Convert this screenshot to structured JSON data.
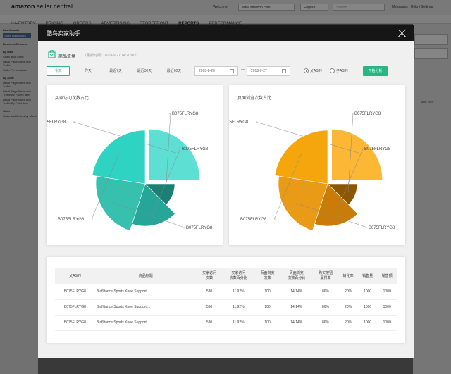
{
  "background": {
    "logo_bold": "amazon",
    "logo_rest": " seller central",
    "welcome": "Welcome",
    "marketplace": "www.amazon.com",
    "language": "English",
    "search_placeholder": "Search",
    "links": "Messages | Help | Settings",
    "nav": [
      "INVENTORY",
      "PRICING",
      "ORDERS",
      "ADVERTISING",
      "STOREFRONT",
      "REPORTS",
      "PERFORMANCE"
    ],
    "sidebar": [
      "Dashboards",
      "Sales Dashboard",
      "Business Reports",
      "By Date",
      "Sales and Traffic",
      "Detail Page Sales and Traffic",
      "Seller Performance",
      "By ASIN",
      "Detail Page Sales and Traffic",
      "Detail Page Sales and Traffic By Parent Item",
      "Detail Page Sales and Traffic By Child Item",
      "Other",
      "Sales and Orders by Month"
    ],
    "right_label": "Table View"
  },
  "modal": {
    "title": "酷鸟卖家助手",
    "section_title": "商品流量",
    "update_time": "（更新时间：2018-9-27 14:20:00）",
    "date_tabs": [
      "今天",
      "昨天",
      "最近7天",
      "最近30天",
      "最近60天"
    ],
    "active_tab": "今天",
    "start_date": "2018-8-26",
    "end_date": "2018-9-27",
    "date_separator": "—",
    "radio_parent": "父ASIN",
    "radio_child": "子ASIN",
    "analyze_button": "开始分析"
  },
  "chart_data": [
    {
      "type": "pie",
      "title": "买家访问次数占比",
      "categories": [
        "B075FLRYG8",
        "B075FLRYG8",
        "B075FLRYG8",
        "B075FLRYG8",
        "B075FLRYG8"
      ],
      "values": [
        25,
        12.5,
        17.5,
        22.5,
        22.5
      ],
      "colors": [
        "#5edfd4",
        "#1b7f74",
        "#26a699",
        "#37c0ae",
        "#2ed3c1"
      ]
    },
    {
      "type": "pie",
      "title": "页面浏览次数占比",
      "categories": [
        "B075FLRYG8",
        "B075FLRYG8",
        "B075FLRYG8",
        "B075FLRYG8",
        "B075FLRYG8"
      ],
      "values": [
        25,
        12.5,
        17.5,
        22.5,
        22.5
      ],
      "colors": [
        "#fcb734",
        "#8d5700",
        "#c97d08",
        "#e99a16",
        "#f5a60c"
      ]
    }
  ],
  "table": {
    "headers": [
      "父ASIN",
      "商品标题",
      "买家访问\n次数",
      "买家访问\n次数百分比",
      "页面浏览\n次数",
      "页面浏览\n次数百分比",
      "购买按钮\n赢得率",
      "转化率",
      "销售量",
      "销售额"
    ],
    "rows": [
      [
        "B075FLRYG8",
        "Blaflitance Sports Knee Support....",
        "530",
        "11.92%",
        "100",
        "14.14%",
        "86%",
        "20%",
        "1000",
        "1000"
      ],
      [
        "B075FLRYG8",
        "Blaflitance Sports Knee Support....",
        "530",
        "11.92%",
        "100",
        "14.14%",
        "86%",
        "20%",
        "1000",
        "1000"
      ],
      [
        "B075FLRYG8",
        "Blaflitance Sports Knee Support....",
        "530",
        "11.92%",
        "100",
        "14.14%",
        "86%",
        "20%",
        "1000",
        "1000"
      ]
    ]
  }
}
